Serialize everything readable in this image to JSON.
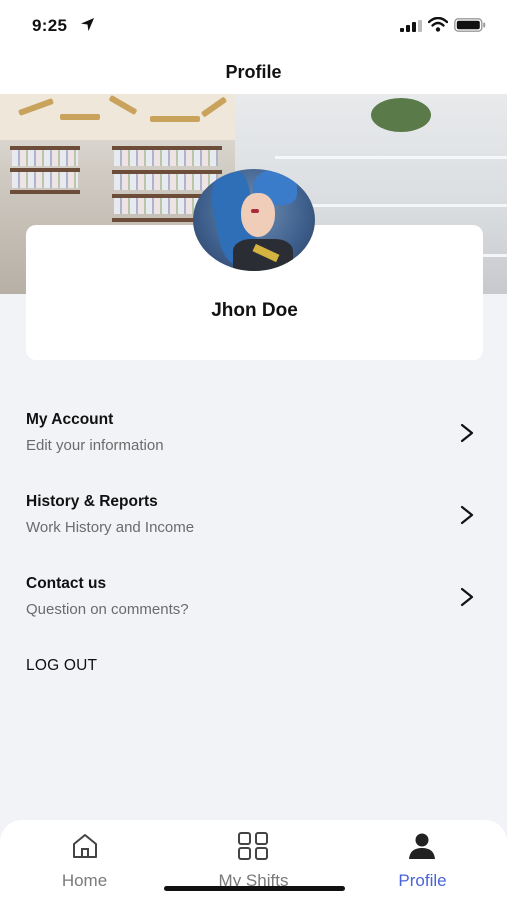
{
  "status_bar": {
    "time": "9:25",
    "icons": [
      "location-arrow-icon",
      "cellular-signal-icon",
      "wifi-icon",
      "battery-icon"
    ]
  },
  "header": {
    "title": "Profile"
  },
  "profile": {
    "name": "Jhon Doe"
  },
  "menu": [
    {
      "title": "My Account",
      "subtitle": "Edit your information",
      "icon": "chevron-right-icon"
    },
    {
      "title": "History & Reports",
      "subtitle": "Work History and Income",
      "icon": "chevron-right-icon"
    },
    {
      "title": "Contact us",
      "subtitle": "Question on comments?",
      "icon": "chevron-right-icon"
    }
  ],
  "logout_label": "LOG OUT",
  "tabs": [
    {
      "label": "Home",
      "icon": "home-icon",
      "active": false
    },
    {
      "label": "My Shifts",
      "icon": "grid-icon",
      "active": false
    },
    {
      "label": "Profile",
      "icon": "person-icon",
      "active": true
    }
  ],
  "colors": {
    "accent": "#4b63d8",
    "background": "#f2f3f7",
    "card": "#ffffff",
    "muted_text": "#6b6b6b"
  }
}
